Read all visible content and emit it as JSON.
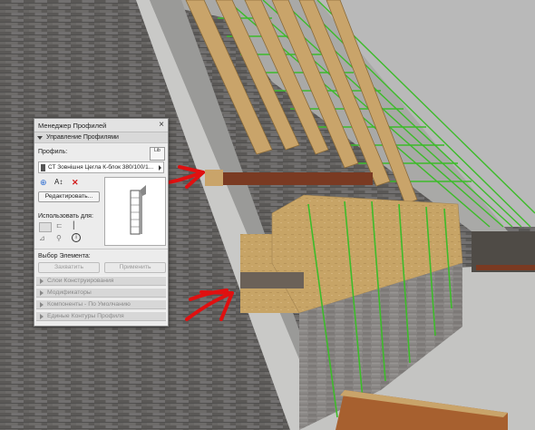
{
  "palette": {
    "title": "Менеджер Профилей",
    "close_glyph": "×",
    "manage_section": "Управление Профилями",
    "profile_label": "Профиль:",
    "profile_value": "СТ Зовнішня Цегла К-блок 380/100/1...",
    "lib_button": "Lib",
    "icons": [
      "add-profile-icon",
      "rename-icon",
      "delete-icon"
    ],
    "rename_glyph": "A↕",
    "edit_button": "Редактировать...",
    "use_for_label": "Использовать для:",
    "select_section": "Выбор Элемента:",
    "capture_button": "Захватить",
    "apply_button": "Применить",
    "panels": [
      "Слои Конструирования",
      "Модификаторы",
      "Компоненты - По Умолчанию",
      "Единые Контуры Профиля"
    ],
    "info_glyph": "i"
  },
  "colors": {
    "arrow": "#e01010",
    "wall": "#5f5e5c",
    "wood": "#c9a46a",
    "green_lines": "#3dbb2a"
  }
}
